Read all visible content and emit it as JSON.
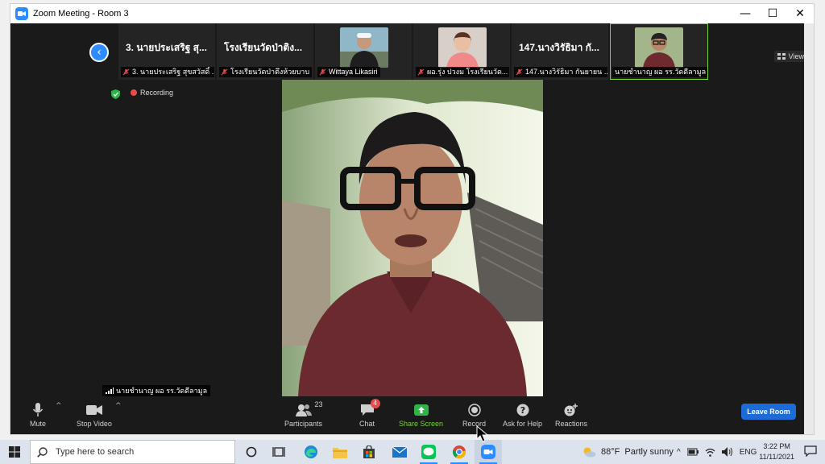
{
  "window": {
    "title": "Zoom Meeting - Room 3",
    "minimize": "—",
    "maximize": "☐",
    "close": "✕"
  },
  "strip": {
    "tiles": [
      {
        "big": "3. นายประเสริฐ สุ...",
        "small": "3. นายประเสริฐ สุขสวัสดิ์ ...",
        "has_video": false
      },
      {
        "big": "โรงเรียนวัดป่าติง...",
        "small": "โรงเรียนวัดป่าตึงห้วยบาบ",
        "has_video": false
      },
      {
        "big": "",
        "small": "Wittaya Likasiri",
        "has_video": true
      },
      {
        "big": "",
        "small": "ผอ.รุ่ง ปวงม โรงเรียนวัด...",
        "has_video": true
      },
      {
        "big": "147.นางวิรัธิมา กั...",
        "small": "147.นางวิรัธิมา กันยายน ...",
        "has_video": false
      },
      {
        "big": "",
        "small": "นายชำนาญ ผอ รร.วัดดีลามูล",
        "has_video": true
      }
    ],
    "view_label": "View"
  },
  "status": {
    "recording": "Recording"
  },
  "speaker": {
    "name": "นายชำนาญ ผอ รร.วัดดีลามูล"
  },
  "toolbar": {
    "mute": "Mute",
    "stop_video": "Stop Video",
    "participants": "Participants",
    "participants_count": "23",
    "chat": "Chat",
    "chat_badge": "4",
    "share_screen": "Share Screen",
    "record": "Record",
    "ask_for_help": "Ask for Help",
    "reactions": "Reactions",
    "leave_room": "Leave Room"
  },
  "taskbar": {
    "search_placeholder": "Type here to search",
    "weather_temp": "88°F",
    "weather_desc": "Partly sunny",
    "language": "ENG",
    "time": "3:22 PM",
    "date": "11/11/2021"
  },
  "colors": {
    "accent": "#2d8cff",
    "active_tile": "#7bd23b",
    "share": "#7bd23b",
    "leave": "#1d6bd6",
    "recording": "#e84b4b"
  }
}
